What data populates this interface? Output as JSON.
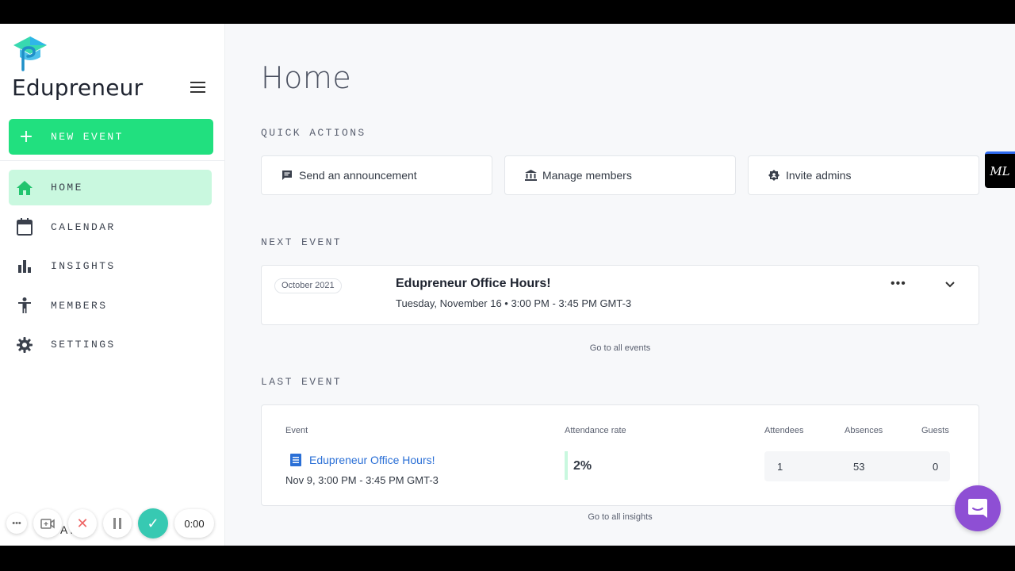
{
  "sidebar": {
    "brand": "Edupreneur",
    "new_event_label": "NEW EVENT",
    "items": [
      {
        "label": "HOME",
        "icon": "home-icon",
        "active": true
      },
      {
        "label": "CALENDAR",
        "icon": "calendar-icon",
        "active": false
      },
      {
        "label": "INSIGHTS",
        "icon": "bar-chart-icon",
        "active": false
      },
      {
        "label": "MEMBERS",
        "icon": "person-icon",
        "active": false
      },
      {
        "label": "SETTINGS",
        "icon": "gear-icon",
        "active": false
      }
    ],
    "account_peek": "A    M"
  },
  "recorder": {
    "timer": "0:00"
  },
  "main": {
    "title": "Home",
    "quick_actions": {
      "label": "QUICK ACTIONS",
      "items": [
        {
          "label": "Send an announcement",
          "icon": "message-icon"
        },
        {
          "label": "Manage members",
          "icon": "bank-icon"
        },
        {
          "label": "Invite admins",
          "icon": "badge-icon"
        }
      ]
    },
    "next_event": {
      "label": "NEXT EVENT",
      "month_pill": "October 2021",
      "title": "Edupreneur Office Hours!",
      "subtitle": "Tuesday, November  16 •  3:00 PM - 3:45 PM GMT-3",
      "go_all": "Go to all events"
    },
    "last_event": {
      "label": "LAST EVENT",
      "headers": {
        "event": "Event",
        "attendance": "Attendance rate",
        "attendees": "Attendees",
        "absences": "Absences",
        "guests": "Guests"
      },
      "name": "Edupreneur Office Hours!",
      "date": "Nov 9, 3:00 PM - 3:45 PM GMT-3",
      "attendance_rate": "2%",
      "attendees": "1",
      "absences": "53",
      "guests": "0",
      "go_all": "Go to all insights"
    }
  },
  "widgets": {
    "ml_badge": "ML"
  },
  "colors": {
    "accent": "#21e07f",
    "active_bg": "#c9f8df",
    "link": "#2a6fd6",
    "chat": "#8e4fd4"
  }
}
